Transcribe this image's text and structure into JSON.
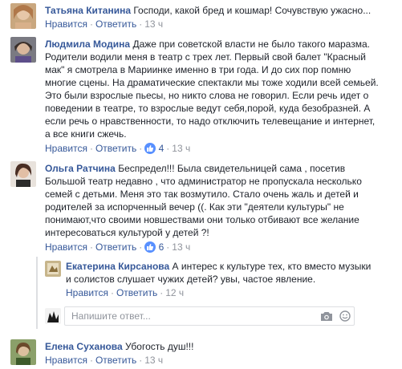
{
  "actions": {
    "like": "Нравится",
    "reply": "Ответить"
  },
  "comments": [
    {
      "author": "Татьяна Китанина",
      "text": "Господи, какой бред и кошмар! Сочувствую ужасно...",
      "time": "13 ч"
    },
    {
      "author": "Людмила Модина",
      "text": "Даже при советской власти не было такого маразма. Родители водили меня в театр с трех лет. Первый свой балет \"Красный мак\" я смотрела в Мариинке именно в три года. И до сих пор помню многие сцены. На драматические спектакли мы тоже ходили всей семьей. Это были взрослые пьесы, но никто слова не говорил. Если речь идет о поведении в театре, то взрослые ведут себя,порой, куда безобразней. А если речь о нравственности, то надо отключить телевещание и интернет, а все книги сжечь.",
      "likes": "4",
      "time": "13 ч"
    },
    {
      "author": "Ольга Ратчина",
      "text": "Беспредел!!! Была свидетельницей сама , посетив Большой театр недавно , что администратор не пропускала несколько семей с детьми. Меня это так возмутило. Стало очень жаль и детей и родителей за испорченный вечер ((. Как эти \"деятели культуры\" не понимают,что своими новшествами они только отбивают все желание интересоваться культурой у детей ?!",
      "likes": "6",
      "time": "13 ч"
    },
    {
      "author": "Екатерина Кирсанова",
      "text": "А интерес к культуре тех, кто вместо музыки и солистов слушает чужих детей? увы, частое явление.",
      "time": "12 ч"
    },
    {
      "author": "Елена Суханова",
      "text": "Убогость душ!!!",
      "time": "13 ч"
    }
  ],
  "reply_input": {
    "placeholder": "Напишите ответ..."
  },
  "icons": [
    "thumbs-up-icon",
    "camera-icon",
    "emoji-icon"
  ],
  "colors": {
    "link": "#365899",
    "meta": "#90949c",
    "like_badge": "#5890ff",
    "border": "#dddfe2"
  }
}
